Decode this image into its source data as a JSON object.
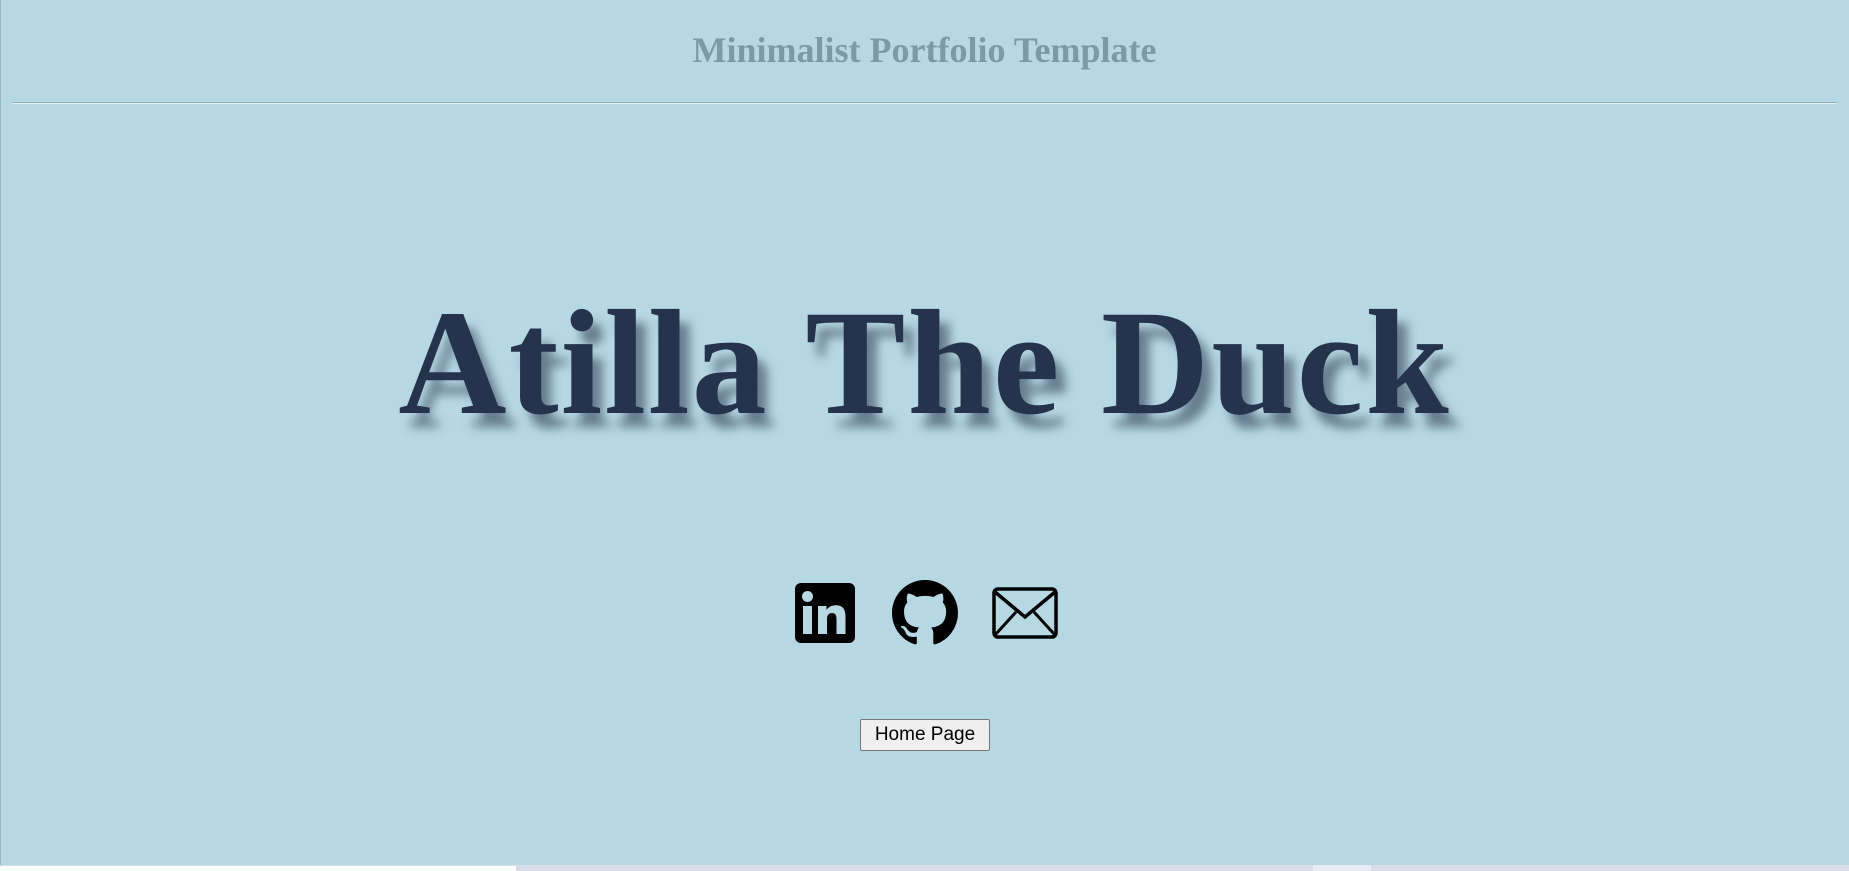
{
  "header": {
    "title": "Minimalist Portfolio Template"
  },
  "hero": {
    "name": "Atilla The Duck"
  },
  "social": {
    "items": [
      {
        "name": "linkedin",
        "icon": "linkedin-icon"
      },
      {
        "name": "github",
        "icon": "github-icon"
      },
      {
        "name": "email",
        "icon": "mail-icon"
      }
    ]
  },
  "actions": {
    "home_label": "Home Page"
  },
  "colors": {
    "background": "#b6d8e3",
    "title": "#7a9aa6",
    "hero_text": "#26334d",
    "icons": "#000000"
  }
}
